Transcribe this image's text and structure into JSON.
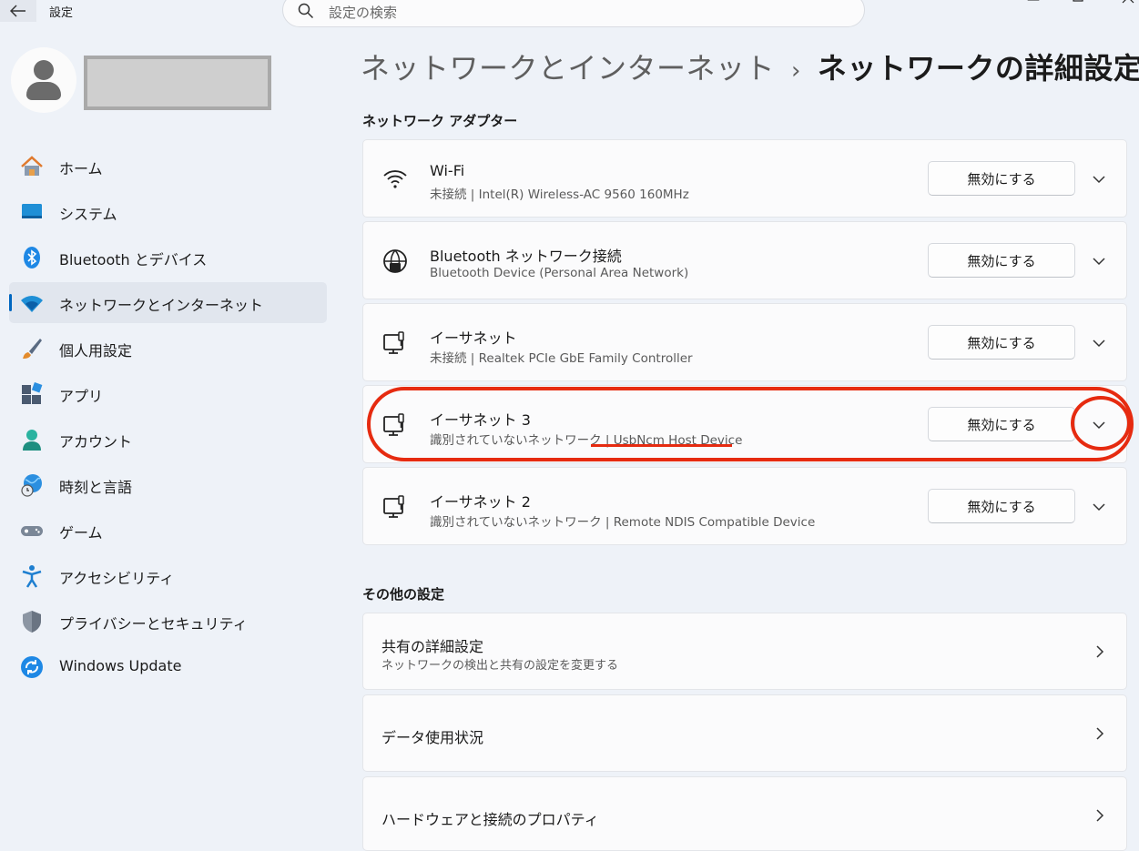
{
  "app": {
    "title": "設定"
  },
  "search": {
    "placeholder": "設定の検索"
  },
  "sidebar": {
    "items": [
      {
        "label": "ホーム",
        "icon": "home-icon"
      },
      {
        "label": "システム",
        "icon": "system-icon"
      },
      {
        "label": "Bluetooth とデバイス",
        "icon": "bluetooth-icon"
      },
      {
        "label": "ネットワークとインターネット",
        "icon": "wifi-icon",
        "active": true
      },
      {
        "label": "個人用設定",
        "icon": "brush-icon"
      },
      {
        "label": "アプリ",
        "icon": "apps-icon"
      },
      {
        "label": "アカウント",
        "icon": "account-icon"
      },
      {
        "label": "時刻と言語",
        "icon": "globe-clock-icon"
      },
      {
        "label": "ゲーム",
        "icon": "gamepad-icon"
      },
      {
        "label": "アクセシビリティ",
        "icon": "accessibility-icon"
      },
      {
        "label": "プライバシーとセキュリティ",
        "icon": "shield-icon"
      },
      {
        "label": "Windows Update",
        "icon": "update-icon"
      }
    ]
  },
  "breadcrumb": {
    "parent": "ネットワークとインターネット",
    "separator": "›",
    "current": "ネットワークの詳細設定"
  },
  "adapters": {
    "section_title": "ネットワーク アダプター",
    "items": [
      {
        "name": "Wi-Fi",
        "detail": "未接続 | Intel(R) Wireless-AC 9560 160MHz",
        "button": "無効にする",
        "icon": "wifi-icon"
      },
      {
        "name": "Bluetooth ネットワーク接続",
        "detail": "Bluetooth Device (Personal Area Network)",
        "button": "無効にする",
        "icon": "bluetooth-network-icon"
      },
      {
        "name": "イーサネット",
        "detail": "未接続 | Realtek PCIe GbE Family Controller",
        "button": "無効にする",
        "icon": "ethernet-icon"
      },
      {
        "name": "イーサネット 3",
        "detail": "識別されていないネットワーク | UsbNcm Host Device",
        "button": "無効にする",
        "icon": "ethernet-icon",
        "highlighted": true
      },
      {
        "name": "イーサネット 2",
        "detail": "識別されていないネットワーク | Remote NDIS Compatible Device",
        "button": "無効にする",
        "icon": "ethernet-icon"
      }
    ]
  },
  "other_settings": {
    "section_title": "その他の設定",
    "items": [
      {
        "title": "共有の詳細設定",
        "subtitle": "ネットワークの検出と共有の設定を変更する"
      },
      {
        "title": "データ使用状況"
      },
      {
        "title": "ハードウェアと接続のプロパティ"
      }
    ]
  },
  "colors": {
    "accent": "#0067c0",
    "highlight": "#e62b10",
    "background": "#eef2f8"
  }
}
